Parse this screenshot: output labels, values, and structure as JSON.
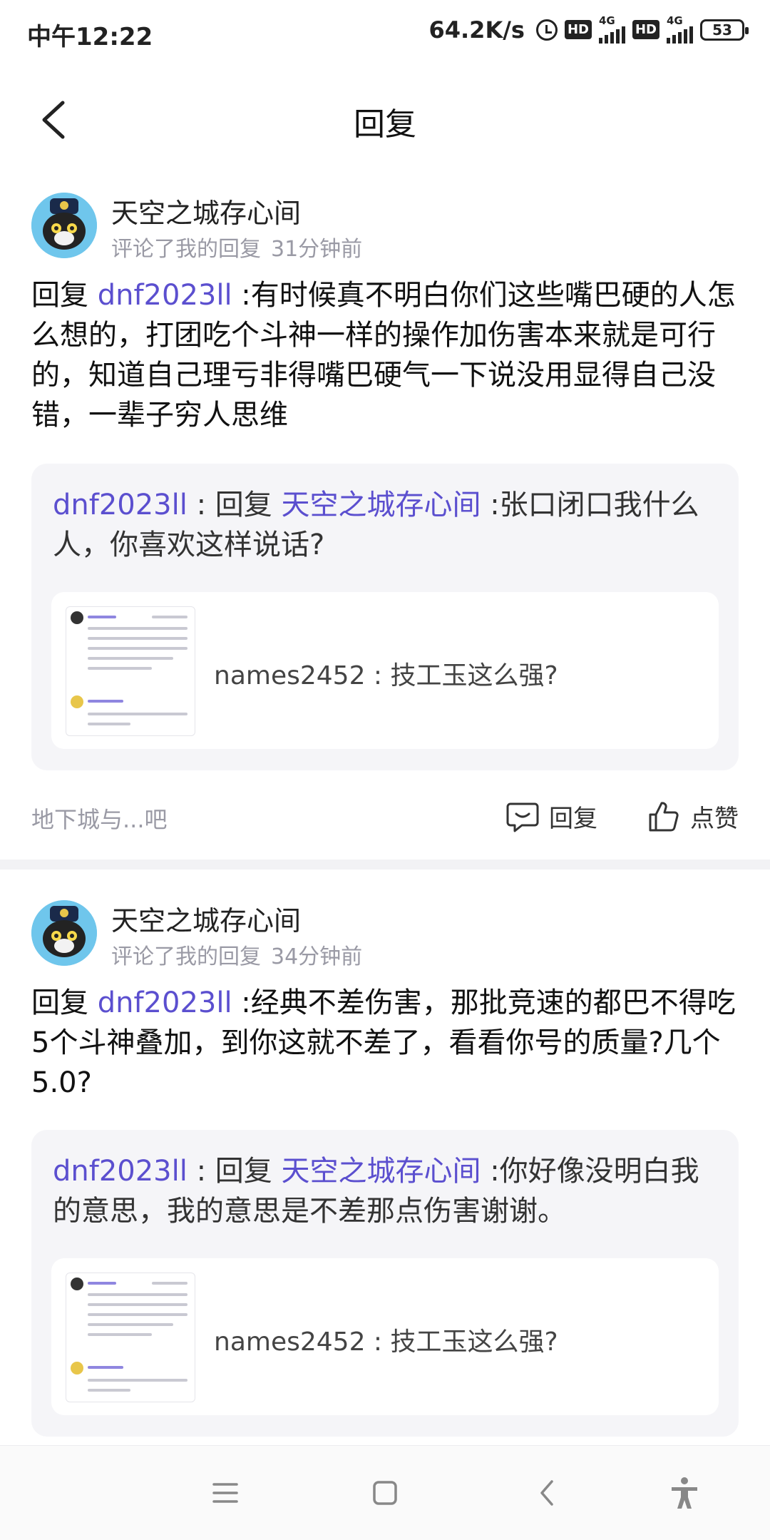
{
  "status_bar": {
    "time": "中午12:22",
    "net_speed": "64.2K/s",
    "hd1": "HD",
    "sig1": "4G",
    "hd2": "HD",
    "sig2": "4G",
    "battery": "53"
  },
  "header": {
    "title": "回复",
    "back_icon": "chevron-left-icon"
  },
  "comments": [
    {
      "username": "天空之城存心间",
      "action": "评论了我的回复",
      "time_ago": "31分钟前",
      "reply_prefix": "回复 ",
      "reply_mention": "dnf2023ll",
      "reply_text": " :有时候真不明白你们这些嘴巴硬的人怎么想的，打团吃个斗神一样的操作加伤害本来就是可行的，知道自己理亏非得嘴巴硬气一下说没用显得自己没错，一辈子穷人思维",
      "quote_author": "dnf2023ll",
      "quote_sep": " : 回复 ",
      "quote_mention": "天空之城存心间",
      "quote_text": " :张口闭口我什么人，你喜欢这样说话?",
      "post_caption": "names2452 : 技工玉这么强?",
      "forum": "地下城与...吧",
      "reply_label": "回复",
      "like_label": "点赞"
    },
    {
      "username": "天空之城存心间",
      "action": "评论了我的回复",
      "time_ago": "34分钟前",
      "reply_prefix": "回复 ",
      "reply_mention": "dnf2023ll",
      "reply_text": " :经典不差伤害，那批竞速的都巴不得吃5个斗神叠加，到你这就不差了，看看你号的质量?几个5.0?",
      "quote_author": "dnf2023ll",
      "quote_sep": " : 回复 ",
      "quote_mention": "天空之城存心间",
      "quote_text": " :你好像没明白我的意思，我的意思是不差那点伤害谢谢。",
      "post_caption": "names2452 : 技工玉这么强?"
    }
  ],
  "nav": {
    "menu_icon": "menu-icon",
    "home_icon": "home-square-icon",
    "back_icon": "back-triangle-icon",
    "accessibility_icon": "accessibility-icon"
  }
}
